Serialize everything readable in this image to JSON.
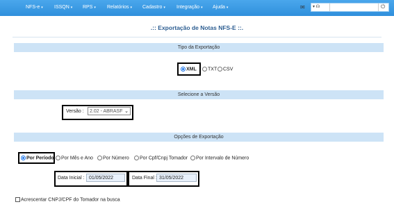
{
  "nav": {
    "items": [
      {
        "label": "NFS-e"
      },
      {
        "label": "ISSQN"
      },
      {
        "label": "RPS"
      },
      {
        "label": "Relatórios"
      },
      {
        "label": "Cadastro"
      },
      {
        "label": "Integração"
      },
      {
        "label": "Ajuda"
      }
    ],
    "icons": {
      "mail": "mail-icon",
      "support": "headset-icon",
      "power": "power-icon"
    }
  },
  "page_title": ".:: Exportação de Notas NFS-E ::.",
  "sections": {
    "tipo": "Tipo da Exportação",
    "versao": "Selecione a Versão",
    "opcoes": "Opções de Exportação"
  },
  "tipo_options": [
    "XML",
    "TXT",
    "CSV"
  ],
  "tipo_selected": "XML",
  "versao_label": "Versão :",
  "versao_value": "2.02 - ABRASF",
  "opcoes": [
    "Por Período",
    "Por Mês e Ano",
    "Por Número",
    "Por Cpf/Cnpj Tomador",
    "Por Intervalo de Número"
  ],
  "opcoes_selected": "Por Período",
  "data_inicial_label": "Data Inicial :",
  "data_inicial_value": "01/05/2022",
  "data_final_label": "Data Final :",
  "data_final_value": "31/05/2022",
  "checkbox_label": "Acrescentar CNPJ/CPF do Tomador na busca",
  "colors": {
    "navbar": "#3399e6",
    "section": "#cde3f6",
    "title": "#2c5d91"
  }
}
